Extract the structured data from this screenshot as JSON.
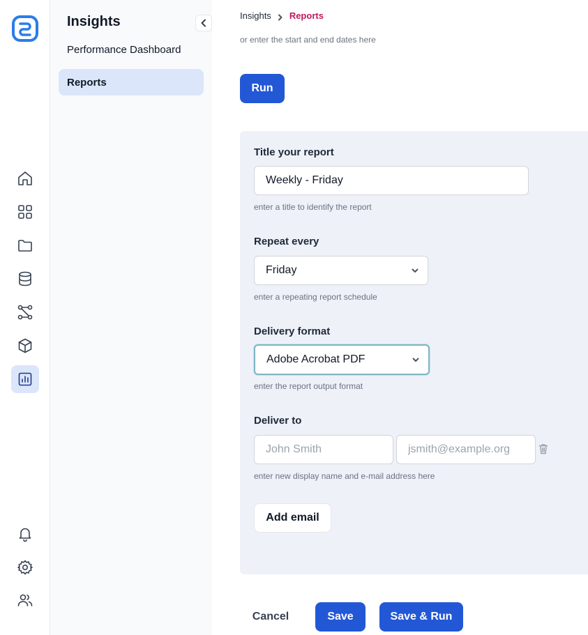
{
  "rail": {
    "icons": [
      "app-logo",
      "home-icon",
      "grid-icon",
      "folder-icon",
      "database-icon",
      "workflow-icon",
      "box-icon",
      "chart-icon",
      "bell-icon",
      "gear-icon",
      "users-icon"
    ]
  },
  "sidebar": {
    "title": "Insights",
    "items": [
      {
        "label": "Performance Dashboard"
      },
      {
        "label": "Reports"
      }
    ]
  },
  "breadcrumb": {
    "parent": "Insights",
    "current": "Reports"
  },
  "dates_hint": "or enter the start and end dates here",
  "run_label": "Run",
  "form": {
    "title_label": "Title your report",
    "title_value": "Weekly - Friday",
    "title_help": "enter a title to identify the report",
    "repeat_label": "Repeat every",
    "repeat_value": "Friday",
    "repeat_help": "enter a repeating report schedule",
    "format_label": "Delivery format",
    "format_value": "Adobe Acrobat PDF",
    "format_help": "enter the report output format",
    "deliver_label": "Deliver to",
    "name_placeholder": "John Smith",
    "email_placeholder": "jsmith@example.org",
    "deliver_help": "enter new display name and e-mail address here",
    "add_email_label": "Add email"
  },
  "footer": {
    "cancel_label": "Cancel",
    "save_label": "Save",
    "save_run_label": "Save & Run"
  },
  "colors": {
    "primary": "#2258d6",
    "active_bg": "#dbe6fb",
    "breadcrumb_current": "#be185d",
    "panel_bg": "#eef1f8"
  }
}
